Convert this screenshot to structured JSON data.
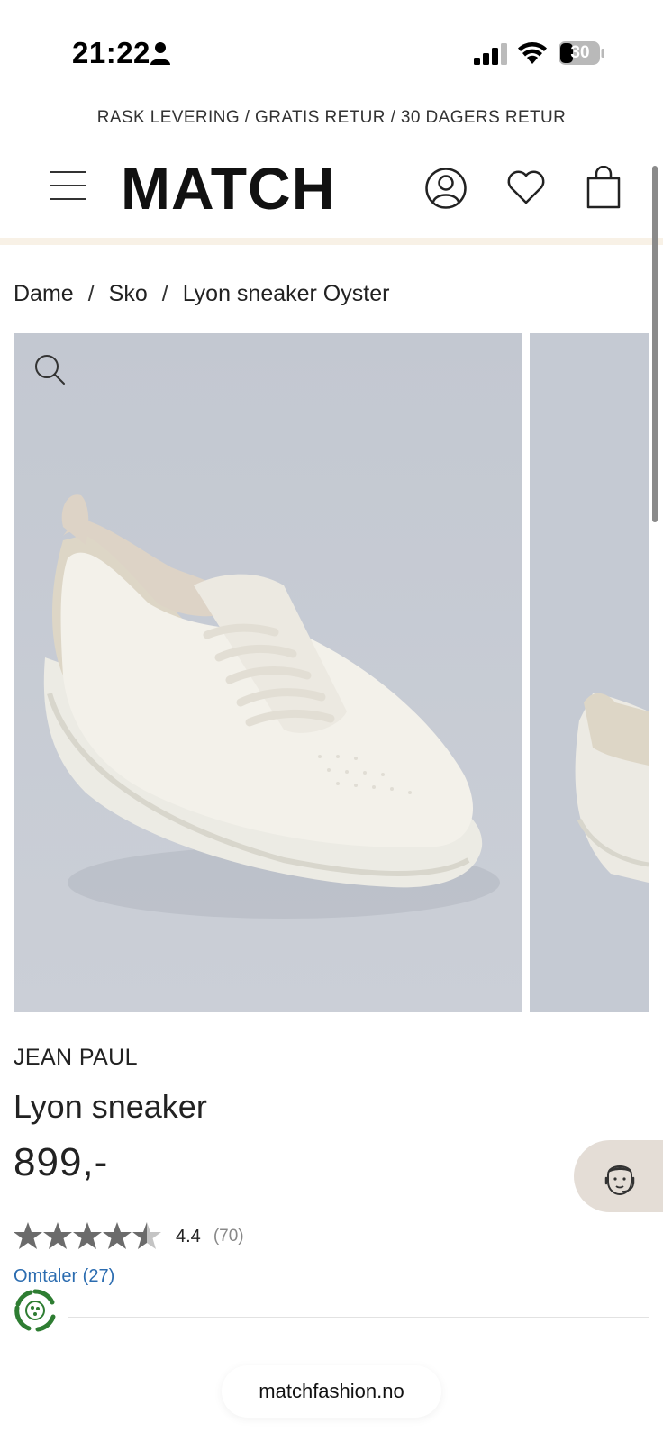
{
  "status_bar": {
    "time": "21:22",
    "battery": "30"
  },
  "promo": {
    "text": "RASK LEVERING / GRATIS RETUR / 30 DAGERS RETUR"
  },
  "header": {
    "logo": "MATCH",
    "icons": [
      "menu-icon",
      "account-icon",
      "heart-icon",
      "bag-icon"
    ]
  },
  "breadcrumb": {
    "items": [
      "Dame",
      "Sko",
      "Lyon sneaker Oyster"
    ],
    "separator": "/"
  },
  "product": {
    "brand": "JEAN PAUL",
    "name": "Lyon sneaker",
    "price": "899,-",
    "rating": {
      "value": "4.4",
      "count": "(70)",
      "stars_filled_fraction": 0.88
    },
    "reviews_link": "Omtaler (27)"
  },
  "browser": {
    "url": "matchfashion.no"
  },
  "colors": {
    "accent_divider": "#f8f1e6",
    "gallery_bg": "#c5cad3",
    "link": "#2b6cb0",
    "chat_bg": "#e4ddd6",
    "eco_green": "#2e7d32"
  }
}
